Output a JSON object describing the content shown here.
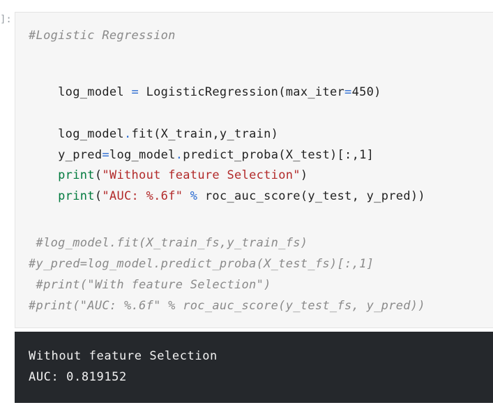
{
  "prompt": "]:",
  "code": {
    "line1": "#Logistic Regression",
    "line2_a": "log_model ",
    "line2_b": "=",
    "line2_c": " LogisticRegression(max_iter",
    "line2_d": "=",
    "line2_e": "450)",
    "line3_a": "log_model",
    "line3_b": ".",
    "line3_c": "fit(X_train,y_train)",
    "line4_a": "y_pred",
    "line4_b": "=",
    "line4_c": "log_model",
    "line4_d": ".",
    "line4_e": "predict_proba(X_test)[:,1]",
    "line5_a": "print",
    "line5_b": "(",
    "line5_c": "\"Without feature Selection\"",
    "line5_d": ")",
    "line6_a": "print",
    "line6_b": "(",
    "line6_c": "\"AUC: %.6f\"",
    "line6_d": " % ",
    "line6_e": "roc_auc_score(y_test, y_pred))",
    "line7": " #log_model.fit(X_train_fs,y_train_fs)",
    "line8": "#y_pred=log_model.predict_proba(X_test_fs)[:,1]",
    "line9": " #print(\"With feature Selection\")",
    "line10": "#print(\"AUC: %.6f\" % roc_auc_score(y_test_fs, y_pred))"
  },
  "output": {
    "line1": "Without feature Selection",
    "line2": "AUC: 0.819152"
  }
}
